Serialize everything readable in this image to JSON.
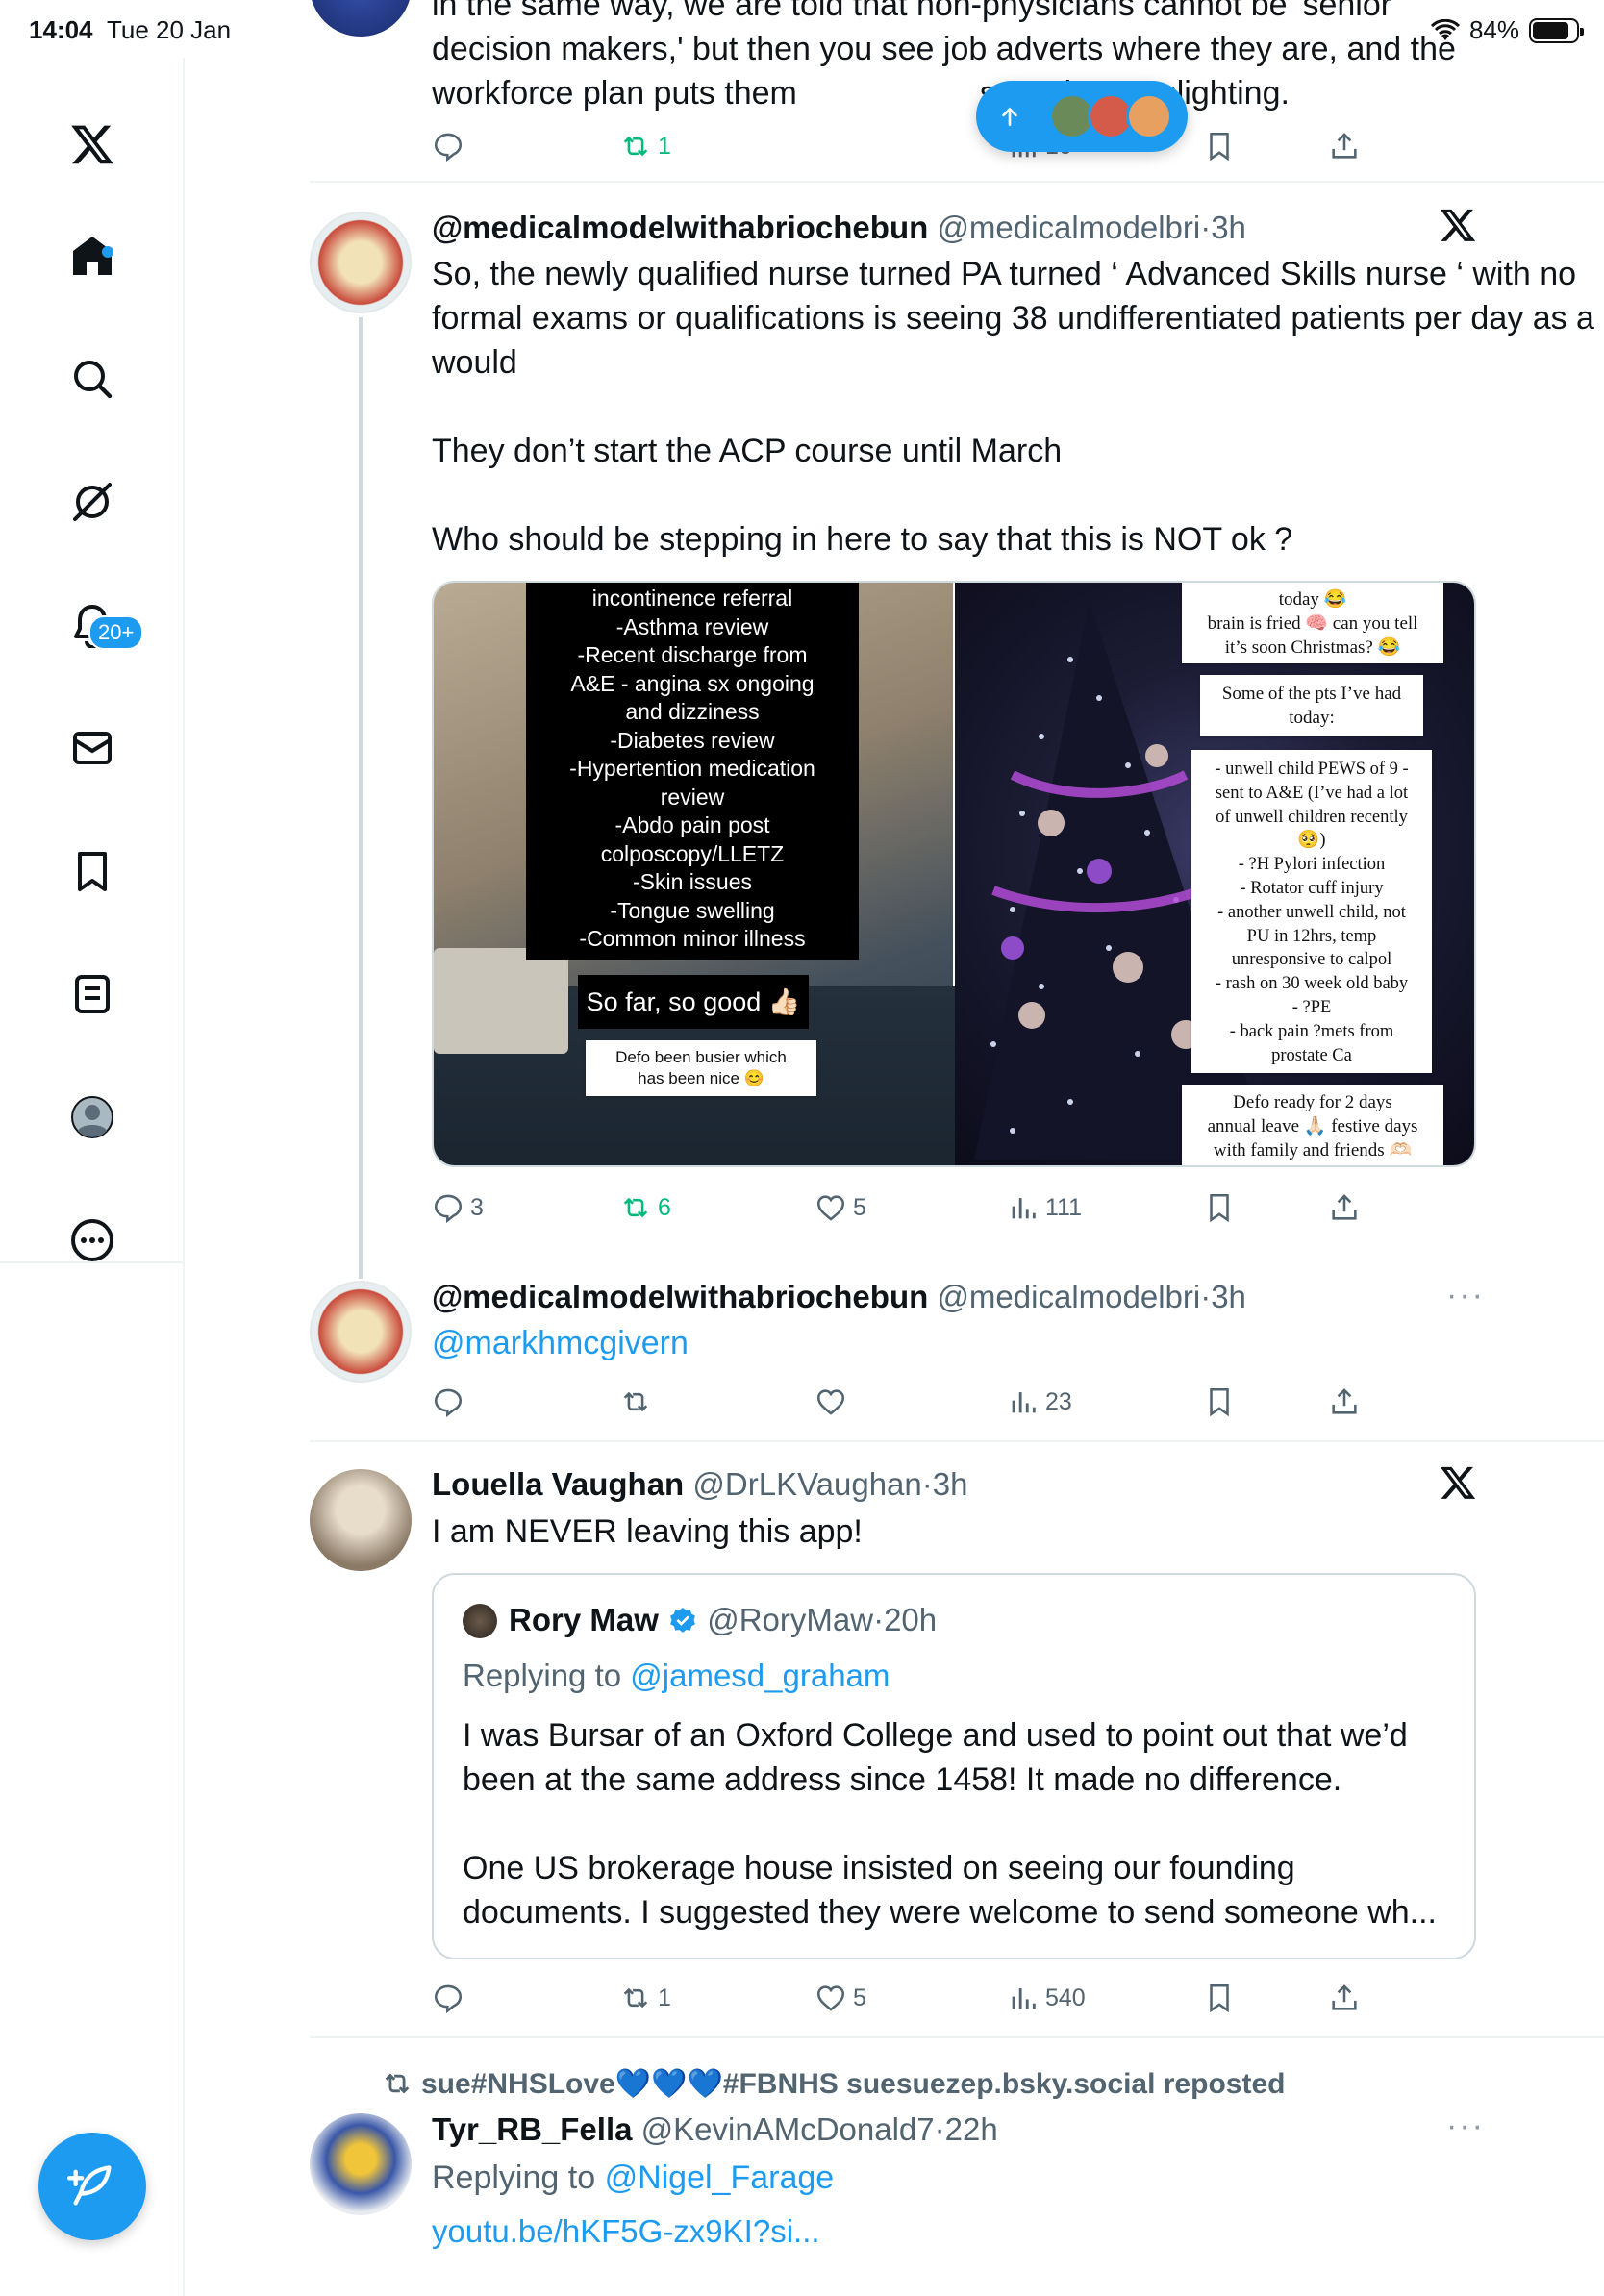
{
  "status_bar": {
    "time": "14:04",
    "date": "Tue 20 Jan",
    "battery_pct": "84%",
    "battery_level": 0.84
  },
  "sidebar": {
    "items": [
      {
        "name": "x-logo-icon"
      },
      {
        "name": "home-icon"
      },
      {
        "name": "search-icon"
      },
      {
        "name": "grok-icon"
      },
      {
        "name": "notifications-icon",
        "badge": "20+"
      },
      {
        "name": "messages-icon"
      },
      {
        "name": "bookmarks-icon"
      },
      {
        "name": "lists-icon"
      },
      {
        "name": "profile-icon"
      },
      {
        "name": "more-icon"
      }
    ]
  },
  "colors": {
    "accent": "#1d9bf0",
    "retweet_green": "#00ba7c",
    "muted": "#536471",
    "border": "#eff3f4"
  },
  "posts": [
    {
      "text_line1": "in the same way, we are told that non-physicians cannot be 'senior",
      "text_line2": "decision makers,' but then you see job adverts where they are, and the",
      "text_line3a": "workforce plan puts them",
      "text_line3b": "s. It's just gaslighting.",
      "actions": {
        "replies": "",
        "reposts": "1",
        "likes": "",
        "views": "10"
      }
    },
    {
      "display_name": "@medicalmodelwithabriochebun",
      "handle": "@medicalmodelbri",
      "time": "3h",
      "text_p1": "So, the newly qualified nurse turned PA turned ‘ Advanced Skills nurse ‘ with no formal exams or qualifications is seeing 38 undifferentiated patients per day as a GP would",
      "text_p2": "They don’t start the ACP course until March",
      "text_p3": "Who should be stepping in here to say that this is NOT ok ?",
      "media_left": {
        "list": [
          "incontinence referral",
          "-Asthma review",
          "-Recent discharge from",
          "A&E - angina sx ongoing",
          "and dizziness",
          "-Diabetes review",
          "-Hypertention medication",
          "review",
          "-Abdo pain post",
          "colposcopy/LLETZ",
          "-Skin issues",
          "-Tongue swelling",
          "-Common minor illness"
        ],
        "caption": "So far, so good 👍🏻",
        "subcaption1": "Defo been busier which",
        "subcaption2": "has been nice 😊"
      },
      "media_right": {
        "top_note1": "today 😂",
        "top_note2": "brain is fried 🧠 can you tell",
        "top_note3": "it’s soon Christmas? 😂",
        "pts_title1": "Some of the pts I’ve had",
        "pts_title2": "today:",
        "pts_list": [
          "- unwell child PEWS of 9 -",
          "sent to A&E (I’ve had a lot",
          "of unwell children recently",
          "🥺)",
          "- ?H Pylori infection",
          "- Rotator cuff injury",
          "- another unwell child, not",
          "PU in 12hrs, temp",
          "unresponsive to calpol",
          "- rash on 30 week old baby",
          "- ?PE",
          "- back pain ?mets from",
          "prostate Ca"
        ],
        "bottom_note1": "Defo ready for 2 days",
        "bottom_note2": "annual leave 🙏🏻 festive days",
        "bottom_note3": "with family and friends 🫶🏻"
      },
      "actions": {
        "replies": "3",
        "reposts": "6",
        "likes": "5",
        "views": "111"
      }
    },
    {
      "display_name": "@medicalmodelwithabriochebun",
      "handle": "@medicalmodelbri",
      "time": "3h",
      "mention": "@markhmcgivern",
      "actions": {
        "replies": "",
        "reposts": "",
        "likes": "",
        "views": "23"
      }
    },
    {
      "display_name": "Louella Vaughan",
      "handle": "@DrLKVaughan",
      "time": "3h",
      "text": "I am NEVER leaving this app!",
      "quote": {
        "display_name": "Rory Maw",
        "handle": "@RoryMaw",
        "time": "20h",
        "replying_prefix": "Replying to",
        "replying_to": "@jamesd_graham",
        "text_p1": "I was Bursar of an Oxford College and used to point out that we’d been at the same address since 1458! It made no difference.",
        "text_p2": "One US brokerage house insisted on seeing our founding documents. I suggested they were welcome to send someone wh..."
      },
      "actions": {
        "replies": "",
        "reposts": "1",
        "likes": "5",
        "views": "540"
      }
    },
    {
      "repost_by": "sue#NHSLove💙💙💙#FBNHS suesuezep.bsky.social reposted",
      "display_name": "Tyr_RB_Fella",
      "handle": "@KevinAMcDonald7",
      "time": "22h",
      "replying_prefix": "Replying to",
      "replying_to": "@Nigel_Farage",
      "link": "youtu.be/hKF5G-zx9KI?si..."
    }
  ],
  "separator": "·"
}
